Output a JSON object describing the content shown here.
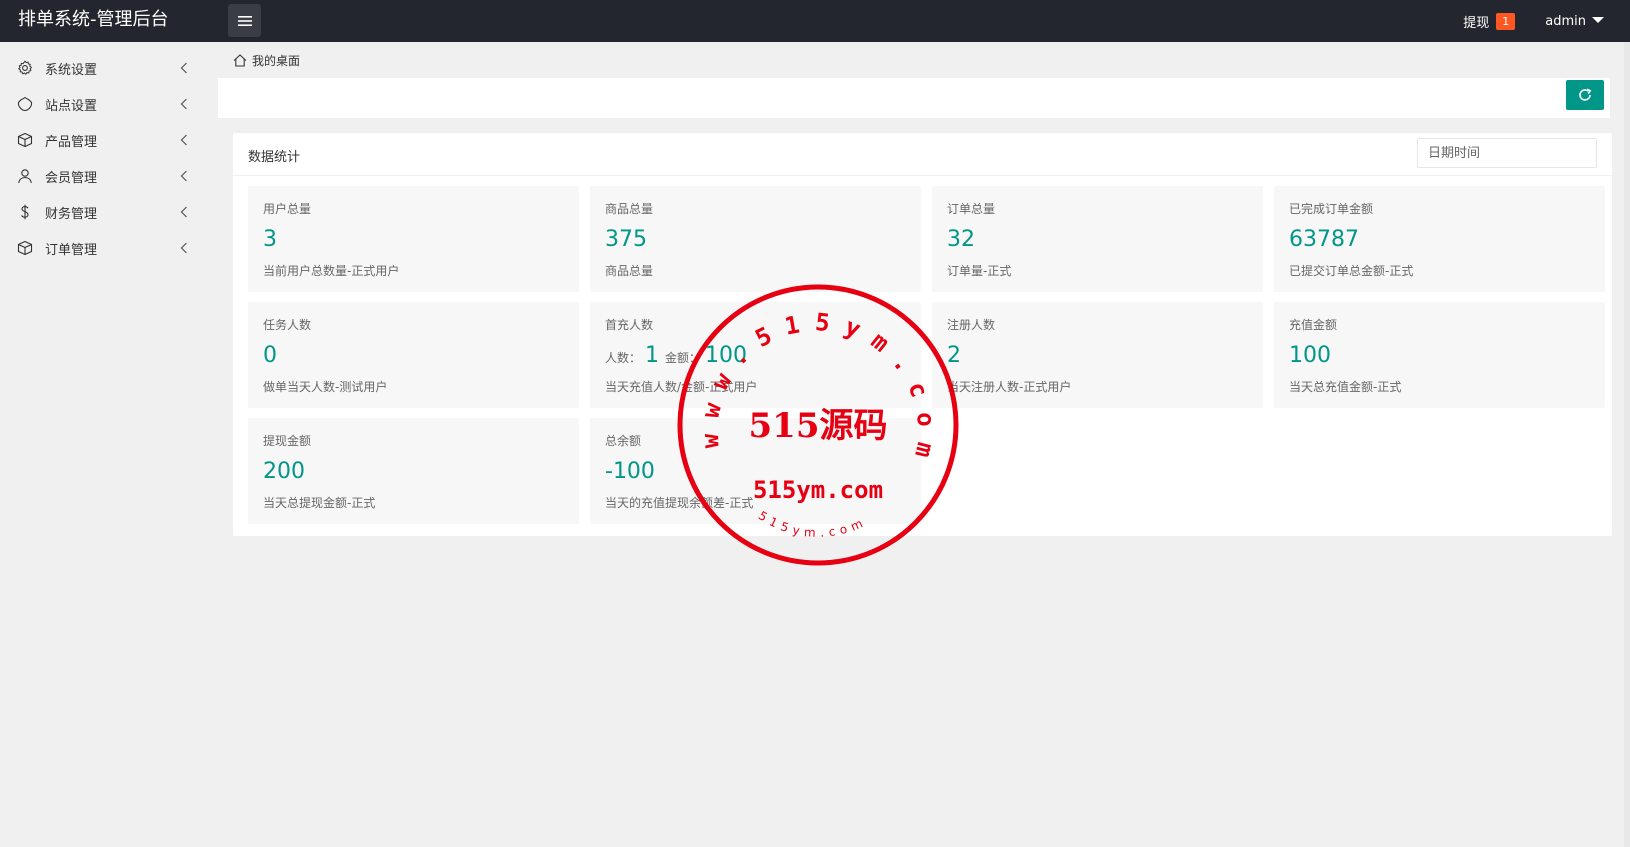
{
  "header": {
    "title": "排单系统-管理后台",
    "withdraw_label": "提现",
    "withdraw_badge": "1",
    "user": "admin"
  },
  "sidebar": {
    "items": [
      {
        "label": "系统设置",
        "icon": "gear-icon"
      },
      {
        "label": "站点设置",
        "icon": "site-icon"
      },
      {
        "label": "产品管理",
        "icon": "box-icon"
      },
      {
        "label": "会员管理",
        "icon": "user-icon"
      },
      {
        "label": "财务管理",
        "icon": "dollar-icon"
      },
      {
        "label": "订单管理",
        "icon": "box-icon"
      }
    ]
  },
  "breadcrumb": {
    "label": "我的桌面"
  },
  "panel": {
    "title": "数据统计",
    "date_placeholder": "日期时间"
  },
  "cards": [
    {
      "title": "用户总量",
      "value": "3",
      "desc": "当前用户总数量-正式用户"
    },
    {
      "title": "商品总量",
      "value": "375",
      "desc": "商品总量"
    },
    {
      "title": "订单总量",
      "value": "32",
      "desc": "订单量-正式"
    },
    {
      "title": "已完成订单金额",
      "value": "63787",
      "desc": "已提交订单总金额-正式"
    },
    {
      "title": "任务人数",
      "value": "0",
      "desc": "做单当天人数-测试用户"
    },
    {
      "title": "首充人数",
      "people_label": "人数：",
      "people": "1",
      "amount_label": "金额：",
      "amount": "100",
      "desc": "当天充值人数/金额-正式用户"
    },
    {
      "title": "注册人数",
      "value": "2",
      "desc": "当天注册人数-正式用户"
    },
    {
      "title": "充值金额",
      "value": "100",
      "desc": "当天总充值金额-正式"
    },
    {
      "title": "提现金额",
      "value": "200",
      "desc": "当天总提现金额-正式"
    },
    {
      "title": "总余额",
      "value": "-100",
      "desc": "当天的充值提现余额差-正式"
    }
  ],
  "watermark": {
    "ring_text": "www.515ym.com",
    "center_text": "515源码",
    "domain_text": "515ym.com",
    "bottom_text": "515ym.com",
    "color": "#e60012"
  },
  "colors": {
    "header_bg": "#23262e",
    "accent": "#009688",
    "badge": "#ff5722"
  }
}
